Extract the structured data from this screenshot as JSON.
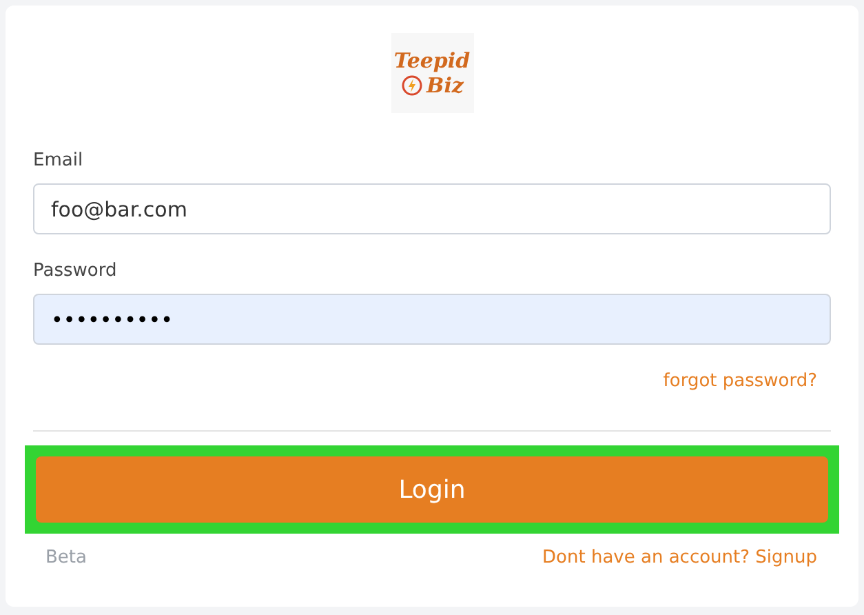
{
  "logo": {
    "line1": "Teepid",
    "line2": "Biz"
  },
  "fields": [
    {
      "label": "Email",
      "value": "foo@bar.com",
      "autofilled": false
    },
    {
      "label": "Password",
      "value": "••••••••••",
      "autofilled": true
    }
  ],
  "forgot_link": "forgot password?",
  "login_button": {
    "label": "Login",
    "focused": true
  },
  "footer": {
    "version": "Beta",
    "signup_link": "Dont have an account? Signup"
  }
}
